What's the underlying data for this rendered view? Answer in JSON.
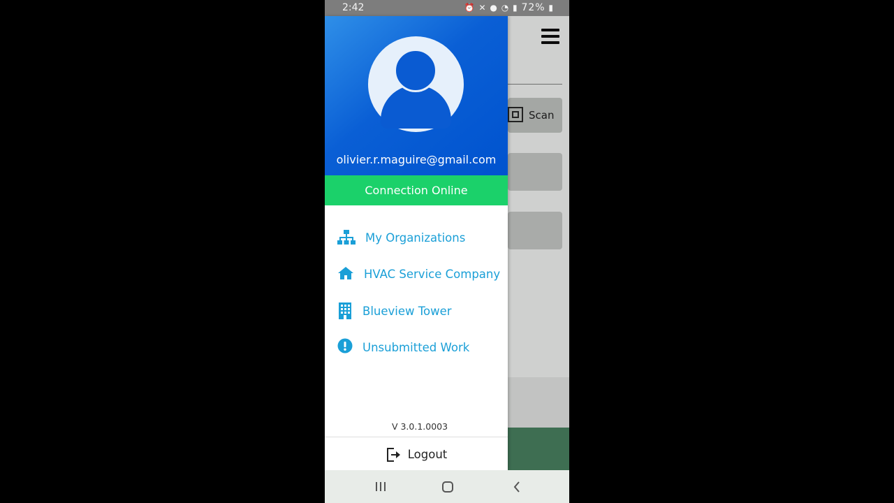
{
  "status_bar": {
    "time": "2:42",
    "icons": [
      "alarm-icon",
      "mute-icon",
      "location-icon",
      "wifi-icon",
      "signal-icon"
    ],
    "battery": "72%"
  },
  "background_app": {
    "scan_label": "Scan"
  },
  "drawer": {
    "email": "olivier.r.maguire@gmail.com",
    "connection_status": "Connection Online",
    "items": [
      {
        "label": "My Organizations",
        "icon": "sitemap-icon"
      },
      {
        "label": "HVAC Service Company",
        "icon": "home-icon"
      },
      {
        "label": "Blueview Tower",
        "icon": "building-icon"
      },
      {
        "label": "Unsubmitted Work",
        "icon": "exclamation-circle-icon"
      }
    ],
    "version": "V 3.0.1.0003",
    "logout_label": "Logout"
  },
  "colors": {
    "header_blue": "#0053cf",
    "connection_green": "#1bd16a",
    "nav_text": "#1a9fd7"
  }
}
